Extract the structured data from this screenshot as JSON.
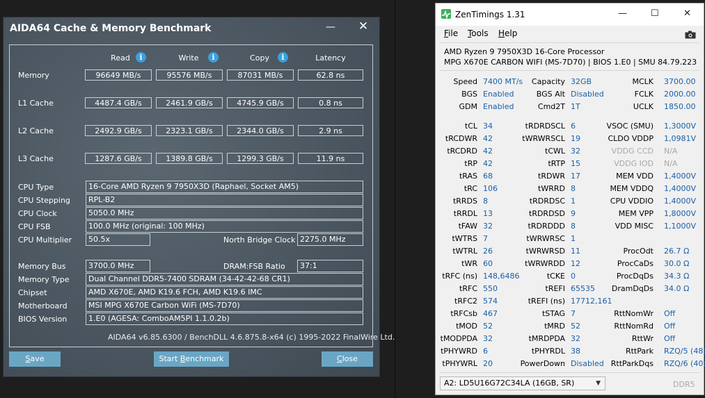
{
  "aida": {
    "title": "AIDA64 Cache & Memory Benchmark",
    "minimize": "—",
    "close_glyph": "✕",
    "headers": {
      "read": "Read",
      "write": "Write",
      "copy": "Copy",
      "latency": "Latency"
    },
    "info_glyph": "i",
    "bench_rows": [
      {
        "label": "Memory",
        "read": "96649 MB/s",
        "write": "95576 MB/s",
        "copy": "87031 MB/s",
        "latency": "62.8 ns"
      },
      {
        "label": "L1 Cache",
        "read": "4487.4 GB/s",
        "write": "2461.9 GB/s",
        "copy": "4745.9 GB/s",
        "latency": "0.8 ns"
      },
      {
        "label": "L2 Cache",
        "read": "2492.9 GB/s",
        "write": "2323.1 GB/s",
        "copy": "2344.0 GB/s",
        "latency": "2.9 ns"
      },
      {
        "label": "L3 Cache",
        "read": "1287.6 GB/s",
        "write": "1389.8 GB/s",
        "copy": "1299.3 GB/s",
        "latency": "11.9 ns"
      }
    ],
    "cpu_type_label": "CPU Type",
    "cpu_type": "16-Core AMD Ryzen 9 7950X3D  (Raphael, Socket AM5)",
    "cpu_stepping_label": "CPU Stepping",
    "cpu_stepping": "RPL-B2",
    "cpu_clock_label": "CPU Clock",
    "cpu_clock": "5050.0 MHz",
    "cpu_fsb_label": "CPU FSB",
    "cpu_fsb": "100.0 MHz  (original: 100 MHz)",
    "cpu_mult_label": "CPU Multiplier",
    "cpu_mult": "50.5x",
    "nb_clock_label": "North Bridge Clock",
    "nb_clock": "2275.0 MHz",
    "mem_bus_label": "Memory Bus",
    "mem_bus": "3700.0 MHz",
    "dram_ratio_label": "DRAM:FSB Ratio",
    "dram_ratio": "37:1",
    "mem_type_label": "Memory Type",
    "mem_type": "Dual Channel DDR5-7400 SDRAM  (34-42-42-68 CR1)",
    "chipset_label": "Chipset",
    "chipset": "AMD X670E, AMD K19.6 FCH, AMD K19.6 IMC",
    "motherboard_label": "Motherboard",
    "motherboard": "MSI MPG X670E Carbon WiFi (MS-7D70)",
    "bios_label": "BIOS Version",
    "bios": "1.E0  (AGESA: ComboAM5PI 1.1.0.2b)",
    "footer": "AIDA64 v6.85.6300 / BenchDLL 4.6.875.8-x64  (c) 1995-2022 FinalWire Ltd.",
    "save_first": "S",
    "save_rest": "ave",
    "start_pre": "Start ",
    "start_u": "B",
    "start_rest": "enchmark",
    "close_first": "C",
    "close_rest": "lose"
  },
  "zen": {
    "title": "ZenTimings 1.31",
    "min_glyph": "—",
    "max_glyph": "☐",
    "close_glyph": "✕",
    "menu_file_u": "F",
    "menu_file_rest": "ile",
    "menu_tools_u": "T",
    "menu_tools_rest": "ools",
    "menu_help_u": "H",
    "menu_help_rest": "elp",
    "cpu": "AMD Ryzen 9 7950X3D 16-Core Processor",
    "board": "MPG X670E CARBON WIFI (MS-7D70) | BIOS 1.E0 | SMU 84.79.223",
    "top": [
      [
        "Speed",
        "7400 MT/s",
        "Capacity",
        "32GB",
        "MCLK",
        "3700.00"
      ],
      [
        "BGS",
        "Enabled",
        "BGS Alt",
        "Disabled",
        "FCLK",
        "2000.00"
      ],
      [
        "GDM",
        "Enabled",
        "Cmd2T",
        "1T",
        "UCLK",
        "1850.00"
      ]
    ],
    "timings": [
      [
        "tCL",
        "34",
        "tRDRDSCL",
        "6",
        "VSOC (SMU)",
        "1,3000V"
      ],
      [
        "tRCDWR",
        "42",
        "tWRWRSCL",
        "19",
        "CLDO VDDP",
        "1,0981V"
      ],
      [
        "tRCDRD",
        "42",
        "tCWL",
        "32",
        "VDDG CCD",
        "N/A"
      ],
      [
        "tRP",
        "42",
        "tRTP",
        "15",
        "VDDG IOD",
        "N/A"
      ],
      [
        "tRAS",
        "68",
        "tRDWR",
        "17",
        "MEM VDD",
        "1,4000V"
      ],
      [
        "tRC",
        "106",
        "tWRRD",
        "8",
        "MEM VDDQ",
        "1,4000V"
      ],
      [
        "tRRDS",
        "8",
        "tRDRDSC",
        "1",
        "CPU VDDIO",
        "1,4000V"
      ],
      [
        "tRRDL",
        "13",
        "tRDRDSD",
        "9",
        "MEM VPP",
        "1,8000V"
      ],
      [
        "tFAW",
        "32",
        "tRDRDDD",
        "8",
        "VDD MISC",
        "1,1000V"
      ],
      [
        "tWTRS",
        "7",
        "tWRWRSC",
        "1",
        "",
        ""
      ],
      [
        "tWTRL",
        "26",
        "tWRWRSD",
        "11",
        "ProcOdt",
        "26.7 Ω"
      ],
      [
        "tWR",
        "60",
        "tWRWRDD",
        "12",
        "ProcCaDs",
        "30.0 Ω"
      ],
      [
        "tRFC (ns)",
        "148,6486",
        "tCKE",
        "0",
        "ProcDqDs",
        "34.3 Ω"
      ],
      [
        "tRFC",
        "550",
        "tREFI",
        "65535",
        "DramDqDs",
        "34.0 Ω"
      ],
      [
        "tRFC2",
        "574",
        "tREFI (ns)",
        "17712,161",
        "",
        ""
      ],
      [
        "tRFCsb",
        "467",
        "tSTAG",
        "7",
        "RttNomWr",
        "Off"
      ],
      [
        "tMOD",
        "52",
        "tMRD",
        "52",
        "RttNomRd",
        "Off"
      ],
      [
        "tMODPDA",
        "32",
        "tMRDPDA",
        "32",
        "RttWr",
        "Off"
      ],
      [
        "tPHYWRD",
        "6",
        "tPHYRDL",
        "38",
        "RttPark",
        "RZQ/5 (48)"
      ],
      [
        "tPHYWRL",
        "20",
        "PowerDown",
        "Disabled",
        "RttParkDqs",
        "RZQ/6 (40)"
      ]
    ],
    "module": "A2: LD5U16G72C34LA (16GB, SR)",
    "dropdown_glyph": "▼",
    "ddr": "DDR5"
  }
}
